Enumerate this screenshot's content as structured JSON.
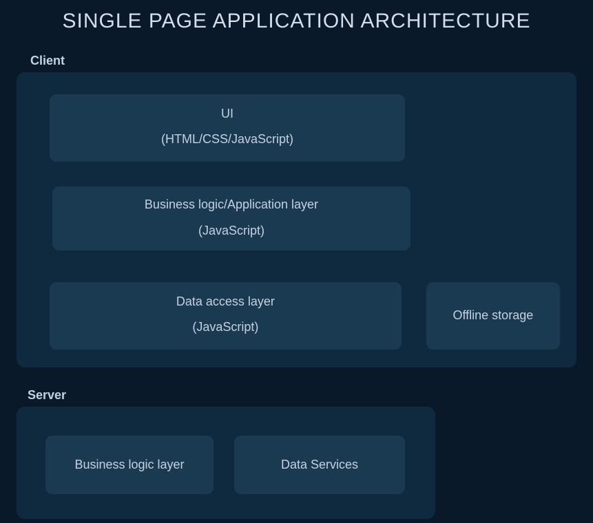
{
  "title": "SINGLE PAGE APPLICATION ARCHITECTURE",
  "client": {
    "label": "Client",
    "ui": {
      "line1": "UI",
      "line2": "(HTML/CSS/JavaScript)"
    },
    "logic": {
      "line1": "Business logic/Application layer",
      "line2": "(JavaScript)"
    },
    "data": {
      "line1": "Data access layer",
      "line2": "(JavaScript)"
    },
    "offline": "Offline storage"
  },
  "server": {
    "label": "Server",
    "logic": "Business logic layer",
    "data": "Data Services"
  }
}
